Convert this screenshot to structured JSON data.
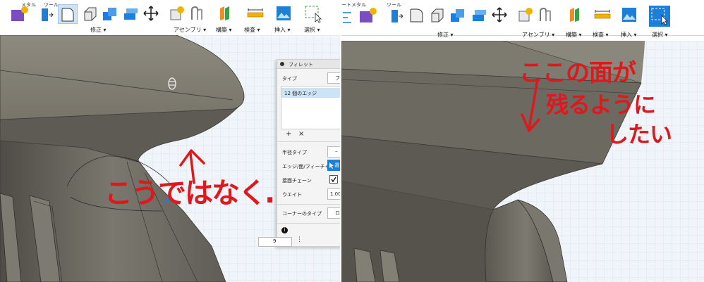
{
  "left_toolbar": {
    "top_labels": [
      "メタル",
      "ツール"
    ],
    "groups": [
      "修正 ▾",
      "アセンブリ ▾",
      "構築 ▾",
      "検査 ▾",
      "挿入 ▾",
      "選択 ▾"
    ]
  },
  "right_toolbar": {
    "top_labels": [
      "ートメタル",
      "ツール"
    ],
    "groups": [
      "修正 ▾",
      "アセンブリ ▾",
      "構築 ▾",
      "検査 ▾",
      "挿入 ▾",
      "選択 ▾"
    ]
  },
  "fillet_panel": {
    "title": "フィレット",
    "type_label": "タイプ",
    "type_value": "フ",
    "selection_item": "12 個のエッジ",
    "add_symbol": "+",
    "remove_symbol": "×",
    "radius_type_label": "半径タイプ",
    "radius_type_value": "–",
    "edge_feature_label": "エッジ/面/フィーチャ",
    "edge_feature_button": "選",
    "tangent_chain_label": "接面チェーン",
    "tangent_chain_checked": true,
    "weight_label": "ウエイト",
    "weight_value": "1.00",
    "corner_type_label": "コーナーのタイプ",
    "corner_type_value": "ロ",
    "info_symbol": "i",
    "value_input": "9"
  },
  "annotations": {
    "left_text": "こうではなく…",
    "right_line1": "ここの面が",
    "right_line2": "残るようにしたい",
    "right_line2a": "残るように",
    "right_line2b": "したい"
  },
  "colors": {
    "annotation_red": "#e0181e",
    "selection_blue": "#1e7fd8",
    "model_gray": "#6b6960"
  }
}
